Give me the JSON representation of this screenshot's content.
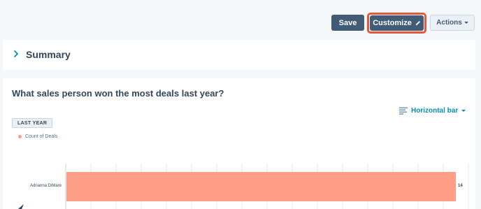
{
  "toolbar": {
    "save_label": "Save",
    "customize_label": "Customize",
    "actions_label": "Actions"
  },
  "summary": {
    "title": "Summary"
  },
  "report": {
    "question": "What sales person won the most deals last year?",
    "visualization_label": "Horizontal bar",
    "period_tag": "LAST YEAR"
  },
  "colors": {
    "primary_button": "#425b76",
    "highlight": "#e5573b",
    "bar": "#ff9e87",
    "accent_link": "#0091ae"
  },
  "chart_data": {
    "type": "bar",
    "orientation": "horizontal",
    "categories": [
      "Adrianna DiMare"
    ],
    "series": [
      {
        "name": "Count of Deals",
        "values": [
          14
        ]
      }
    ],
    "data_labels": [
      "14"
    ],
    "grid": true,
    "legend_placement": "top-left"
  }
}
